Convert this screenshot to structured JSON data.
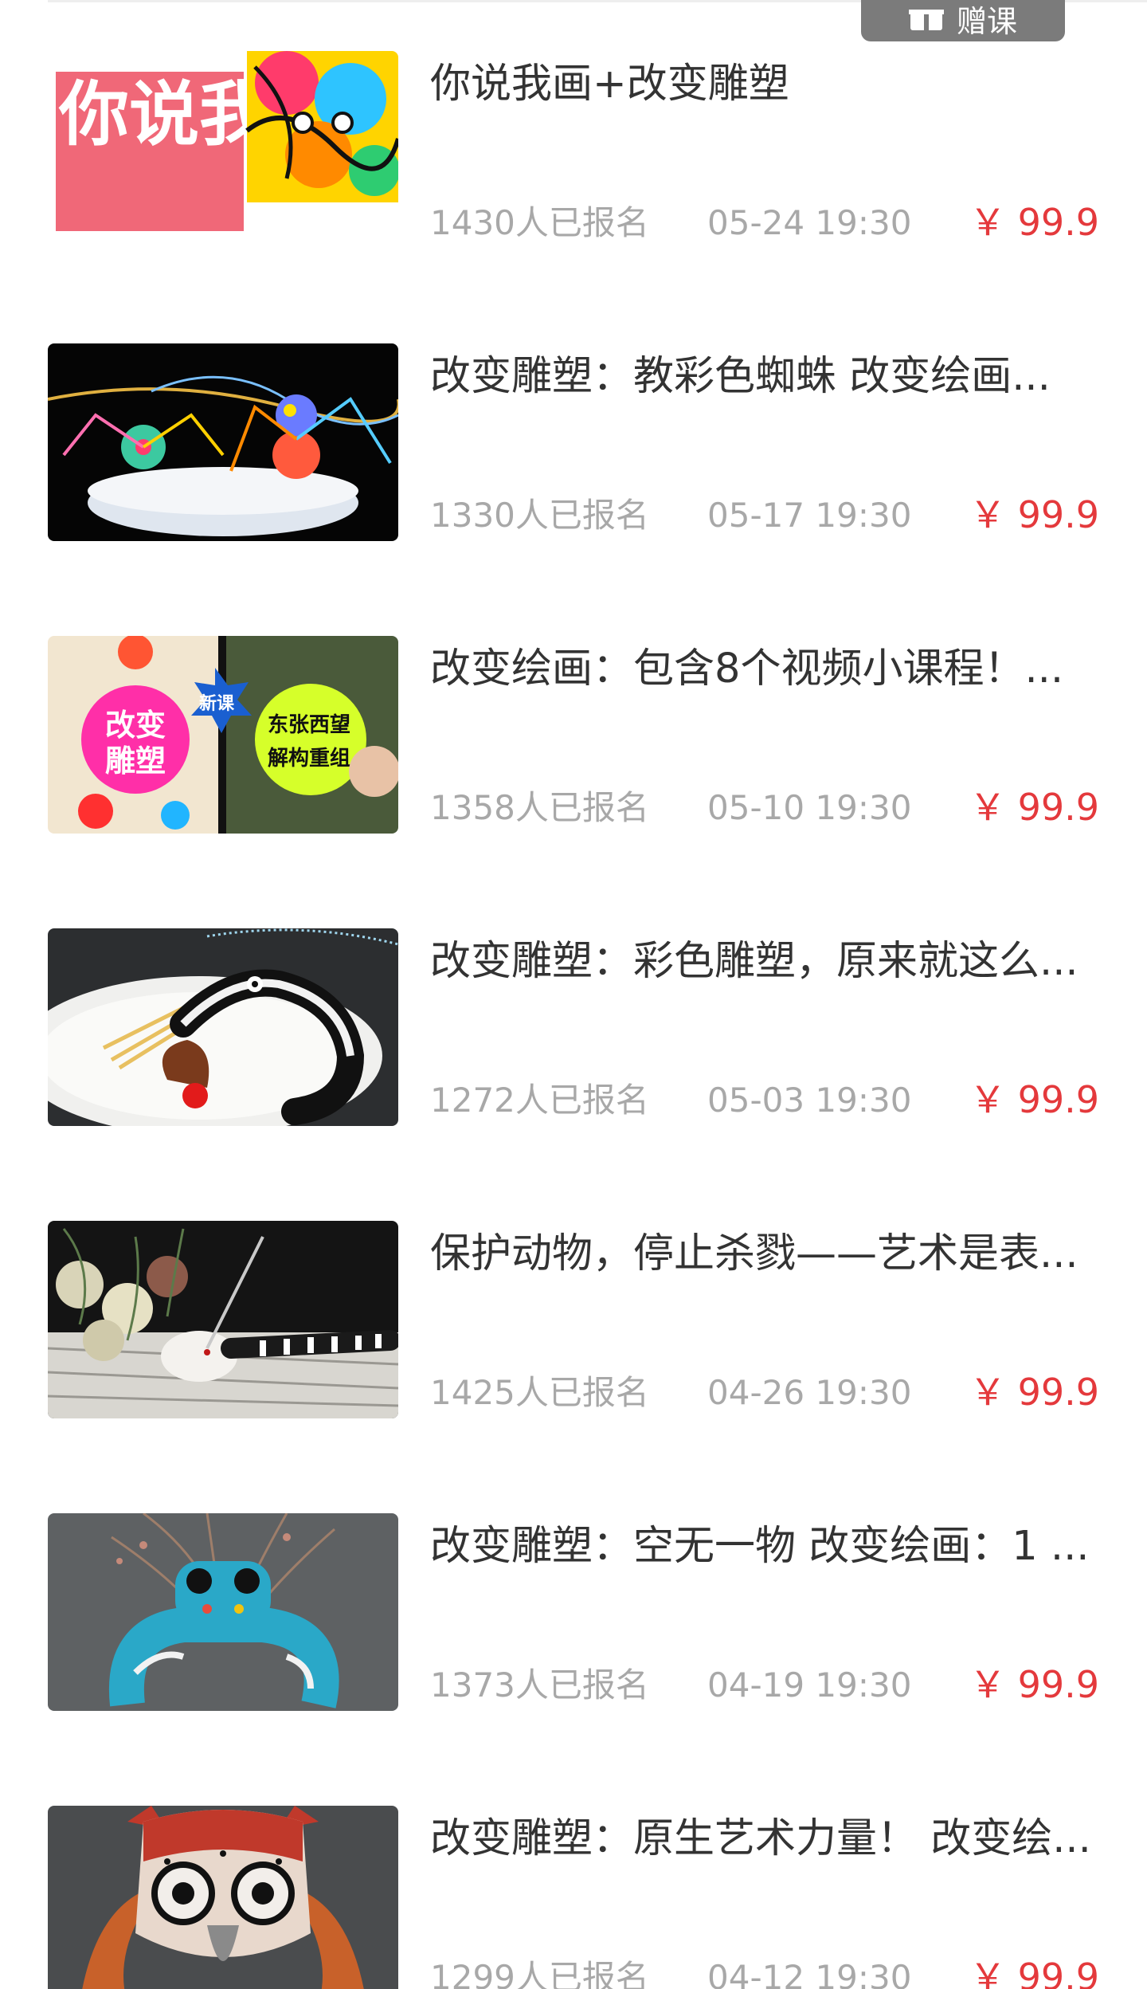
{
  "gift_button": {
    "label": "赠课",
    "icon": "gift-icon"
  },
  "colors": {
    "price": "#e4393c",
    "meta_text": "#a8a8a8",
    "title_text": "#333333",
    "gift_button_bg": "#7b7b7b"
  },
  "courses": [
    {
      "title": "你说我画+改变雕塑",
      "enrolled": "1430人已报名",
      "time": "05-24 19:30",
      "price": "￥ 99.9",
      "thumb_text": "你说我画"
    },
    {
      "title": "改变雕塑：教彩色蜘蛛  改变绘画...",
      "enrolled": "1330人已报名",
      "time": "05-17 19:30",
      "price": "￥ 99.9"
    },
    {
      "title": "改变绘画：包含8个视频小课程！...",
      "enrolled": "1358人已报名",
      "time": "05-10 19:30",
      "price": "￥ 99.9",
      "thumb_texts": [
        "改变",
        "雕塑",
        "新课",
        "东张西望",
        "解构重组"
      ]
    },
    {
      "title": "改变雕塑：彩色雕塑，原来就这么...",
      "enrolled": "1272人已报名",
      "time": "05-03 19:30",
      "price": "￥ 99.9"
    },
    {
      "title": "保护动物，停止杀戮——艺术是表...",
      "enrolled": "1425人已报名",
      "time": "04-26 19:30",
      "price": "￥ 99.9"
    },
    {
      "title": "改变雕塑：空无一物  改变绘画：1 ...",
      "enrolled": "1373人已报名",
      "time": "04-19 19:30",
      "price": "￥ 99.9"
    },
    {
      "title": "改变雕塑：原生艺术力量！ 改变绘...",
      "enrolled": "1299人已报名",
      "time": "04-12 19:30",
      "price": "￥ 99.9"
    }
  ]
}
